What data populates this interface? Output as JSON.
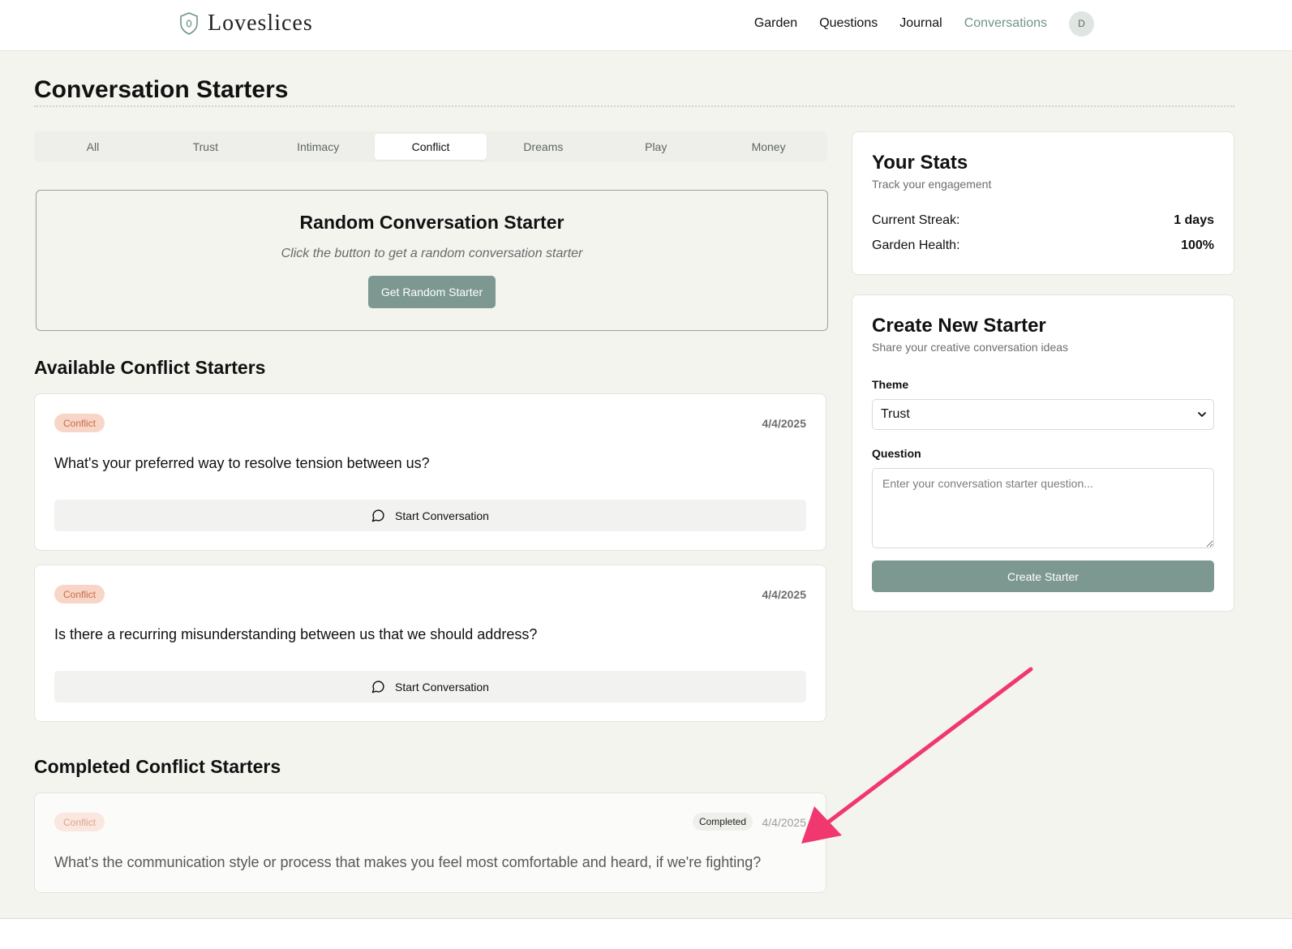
{
  "header": {
    "brand": "Loveslices",
    "nav": [
      "Garden",
      "Questions",
      "Journal",
      "Conversations"
    ],
    "active_nav": "Conversations",
    "avatar_initial": "D"
  },
  "page": {
    "title": "Conversation Starters"
  },
  "tabs": [
    "All",
    "Trust",
    "Intimacy",
    "Conflict",
    "Dreams",
    "Play",
    "Money"
  ],
  "active_tab": "Conflict",
  "random": {
    "title": "Random Conversation Starter",
    "subtitle": "Click the button to get a random conversation starter",
    "button": "Get Random Starter"
  },
  "available": {
    "heading": "Available Conflict Starters",
    "cards": [
      {
        "badge": "Conflict",
        "date": "4/4/2025",
        "question": "What's your preferred way to resolve tension between us?",
        "button": "Start Conversation"
      },
      {
        "badge": "Conflict",
        "date": "4/4/2025",
        "question": "Is there a recurring misunderstanding between us that we should address?",
        "button": "Start Conversation"
      }
    ]
  },
  "completed": {
    "heading": "Completed Conflict Starters",
    "cards": [
      {
        "badge": "Conflict",
        "status": "Completed",
        "date": "4/4/2025",
        "question": "What's the communication style or process that makes you feel most comfortable and heard, if we're fighting?"
      }
    ]
  },
  "stats": {
    "title": "Your Stats",
    "subtitle": "Track your engagement",
    "rows": [
      {
        "label": "Current Streak:",
        "value": "1 days"
      },
      {
        "label": "Garden Health:",
        "value": "100%"
      }
    ]
  },
  "create": {
    "title": "Create New Starter",
    "subtitle": "Share your creative conversation ideas",
    "theme_label": "Theme",
    "theme_value": "Trust",
    "question_label": "Question",
    "question_placeholder": "Enter your conversation starter question...",
    "button": "Create Starter"
  },
  "colors": {
    "accent": "#7d9891",
    "active_nav": "#6f938a",
    "badge_bg": "#f7d6c8",
    "badge_text": "#cf6a48",
    "annotation_arrow": "#f0386f"
  }
}
